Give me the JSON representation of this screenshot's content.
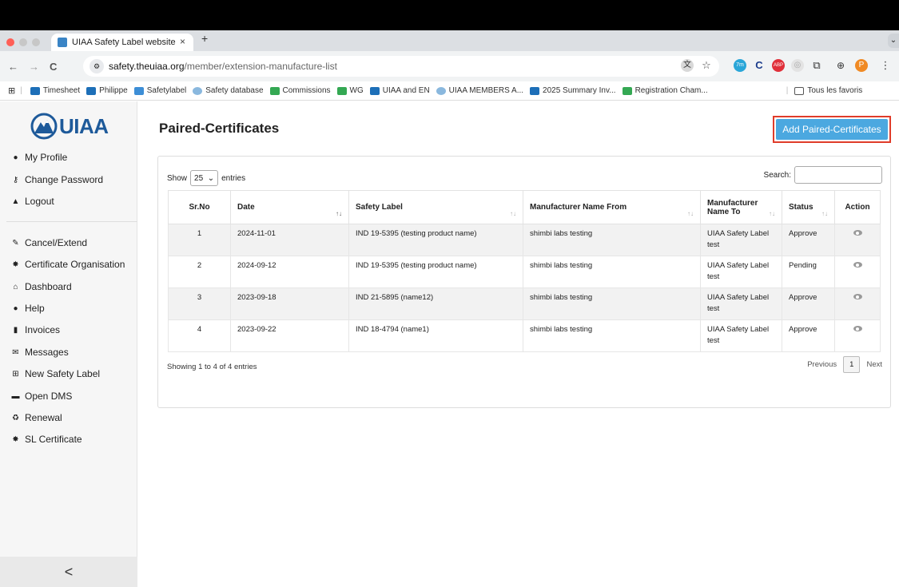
{
  "browser": {
    "tab_title": "UIAA Safety Label website",
    "tab_close": "×",
    "new_tab": "+",
    "url_host": "safety.theuiaa.org",
    "url_path": "/member/extension-manufacture-list",
    "back": "←",
    "forward": "→",
    "reload": "C",
    "bookmarks": [
      "Timesheet",
      "Philippe",
      "Safetylabel",
      "Safety database",
      "Commissions",
      "WG",
      "UIAA and EN",
      "UIAA MEMBERS A...",
      "2025 Summary Inv...",
      "Registration Cham..."
    ],
    "all_favorites": "Tous les favoris",
    "profile_initial": "P",
    "ext_badge": "7m",
    "abp": "ABP"
  },
  "sidebar": {
    "logo_text": "UIAA",
    "account_items": [
      "My Profile",
      "Change Password",
      "Logout"
    ],
    "nav_items": [
      "Cancel/Extend",
      "Certificate Organisation",
      "Dashboard",
      "Help",
      "Invoices",
      "Messages",
      "New Safety Label",
      "Open DMS",
      "Renewal",
      "SL Certificate"
    ],
    "collapse": "<"
  },
  "main": {
    "title": "Paired-Certificates",
    "add_button": "Add Paired-Certificates",
    "show_label": "Show",
    "entries_value": "25",
    "entries_label": "entries",
    "search_label": "Search:",
    "columns": [
      "Sr.No",
      "Date",
      "Safety Label",
      "Manufacturer Name From",
      "Manufacturer Name To",
      "Status",
      "Action"
    ],
    "rows": [
      {
        "sr": "1",
        "date": "2024-11-01",
        "label": "IND 19-5395 (testing product name)",
        "from": "shimbi labs testing",
        "to": "UIAA Safety Label test",
        "status": "Approve"
      },
      {
        "sr": "2",
        "date": "2024-09-12",
        "label": "IND 19-5395 (testing product name)",
        "from": "shimbi labs testing",
        "to": "UIAA Safety Label test",
        "status": "Pending"
      },
      {
        "sr": "3",
        "date": "2023-09-18",
        "label": "IND 21-5895 (name12)",
        "from": "shimbi labs testing",
        "to": "UIAA Safety Label test",
        "status": "Approve"
      },
      {
        "sr": "4",
        "date": "2023-09-22",
        "label": "IND 18-4794 (name1)",
        "from": "shimbi labs testing",
        "to": "UIAA Safety Label test",
        "status": "Approve"
      }
    ],
    "info": "Showing 1 to 4 of 4 entries",
    "prev": "Previous",
    "page": "1",
    "next": "Next"
  }
}
